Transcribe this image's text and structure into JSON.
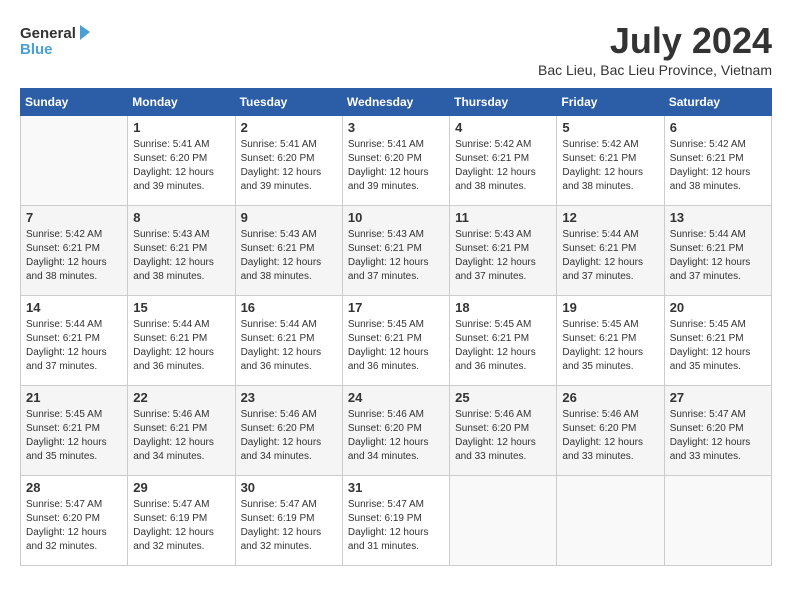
{
  "logo": {
    "line1": "General",
    "line2": "Blue"
  },
  "title": "July 2024",
  "subtitle": "Bac Lieu, Bac Lieu Province, Vietnam",
  "days_of_week": [
    "Sunday",
    "Monday",
    "Tuesday",
    "Wednesday",
    "Thursday",
    "Friday",
    "Saturday"
  ],
  "weeks": [
    [
      {
        "day": "",
        "info": ""
      },
      {
        "day": "1",
        "info": "Sunrise: 5:41 AM\nSunset: 6:20 PM\nDaylight: 12 hours\nand 39 minutes."
      },
      {
        "day": "2",
        "info": "Sunrise: 5:41 AM\nSunset: 6:20 PM\nDaylight: 12 hours\nand 39 minutes."
      },
      {
        "day": "3",
        "info": "Sunrise: 5:41 AM\nSunset: 6:20 PM\nDaylight: 12 hours\nand 39 minutes."
      },
      {
        "day": "4",
        "info": "Sunrise: 5:42 AM\nSunset: 6:21 PM\nDaylight: 12 hours\nand 38 minutes."
      },
      {
        "day": "5",
        "info": "Sunrise: 5:42 AM\nSunset: 6:21 PM\nDaylight: 12 hours\nand 38 minutes."
      },
      {
        "day": "6",
        "info": "Sunrise: 5:42 AM\nSunset: 6:21 PM\nDaylight: 12 hours\nand 38 minutes."
      }
    ],
    [
      {
        "day": "7",
        "info": "Sunrise: 5:42 AM\nSunset: 6:21 PM\nDaylight: 12 hours\nand 38 minutes."
      },
      {
        "day": "8",
        "info": "Sunrise: 5:43 AM\nSunset: 6:21 PM\nDaylight: 12 hours\nand 38 minutes."
      },
      {
        "day": "9",
        "info": "Sunrise: 5:43 AM\nSunset: 6:21 PM\nDaylight: 12 hours\nand 38 minutes."
      },
      {
        "day": "10",
        "info": "Sunrise: 5:43 AM\nSunset: 6:21 PM\nDaylight: 12 hours\nand 37 minutes."
      },
      {
        "day": "11",
        "info": "Sunrise: 5:43 AM\nSunset: 6:21 PM\nDaylight: 12 hours\nand 37 minutes."
      },
      {
        "day": "12",
        "info": "Sunrise: 5:44 AM\nSunset: 6:21 PM\nDaylight: 12 hours\nand 37 minutes."
      },
      {
        "day": "13",
        "info": "Sunrise: 5:44 AM\nSunset: 6:21 PM\nDaylight: 12 hours\nand 37 minutes."
      }
    ],
    [
      {
        "day": "14",
        "info": "Sunrise: 5:44 AM\nSunset: 6:21 PM\nDaylight: 12 hours\nand 37 minutes."
      },
      {
        "day": "15",
        "info": "Sunrise: 5:44 AM\nSunset: 6:21 PM\nDaylight: 12 hours\nand 36 minutes."
      },
      {
        "day": "16",
        "info": "Sunrise: 5:44 AM\nSunset: 6:21 PM\nDaylight: 12 hours\nand 36 minutes."
      },
      {
        "day": "17",
        "info": "Sunrise: 5:45 AM\nSunset: 6:21 PM\nDaylight: 12 hours\nand 36 minutes."
      },
      {
        "day": "18",
        "info": "Sunrise: 5:45 AM\nSunset: 6:21 PM\nDaylight: 12 hours\nand 36 minutes."
      },
      {
        "day": "19",
        "info": "Sunrise: 5:45 AM\nSunset: 6:21 PM\nDaylight: 12 hours\nand 35 minutes."
      },
      {
        "day": "20",
        "info": "Sunrise: 5:45 AM\nSunset: 6:21 PM\nDaylight: 12 hours\nand 35 minutes."
      }
    ],
    [
      {
        "day": "21",
        "info": "Sunrise: 5:45 AM\nSunset: 6:21 PM\nDaylight: 12 hours\nand 35 minutes."
      },
      {
        "day": "22",
        "info": "Sunrise: 5:46 AM\nSunset: 6:21 PM\nDaylight: 12 hours\nand 34 minutes."
      },
      {
        "day": "23",
        "info": "Sunrise: 5:46 AM\nSunset: 6:20 PM\nDaylight: 12 hours\nand 34 minutes."
      },
      {
        "day": "24",
        "info": "Sunrise: 5:46 AM\nSunset: 6:20 PM\nDaylight: 12 hours\nand 34 minutes."
      },
      {
        "day": "25",
        "info": "Sunrise: 5:46 AM\nSunset: 6:20 PM\nDaylight: 12 hours\nand 33 minutes."
      },
      {
        "day": "26",
        "info": "Sunrise: 5:46 AM\nSunset: 6:20 PM\nDaylight: 12 hours\nand 33 minutes."
      },
      {
        "day": "27",
        "info": "Sunrise: 5:47 AM\nSunset: 6:20 PM\nDaylight: 12 hours\nand 33 minutes."
      }
    ],
    [
      {
        "day": "28",
        "info": "Sunrise: 5:47 AM\nSunset: 6:20 PM\nDaylight: 12 hours\nand 32 minutes."
      },
      {
        "day": "29",
        "info": "Sunrise: 5:47 AM\nSunset: 6:19 PM\nDaylight: 12 hours\nand 32 minutes."
      },
      {
        "day": "30",
        "info": "Sunrise: 5:47 AM\nSunset: 6:19 PM\nDaylight: 12 hours\nand 32 minutes."
      },
      {
        "day": "31",
        "info": "Sunrise: 5:47 AM\nSunset: 6:19 PM\nDaylight: 12 hours\nand 31 minutes."
      },
      {
        "day": "",
        "info": ""
      },
      {
        "day": "",
        "info": ""
      },
      {
        "day": "",
        "info": ""
      }
    ]
  ]
}
